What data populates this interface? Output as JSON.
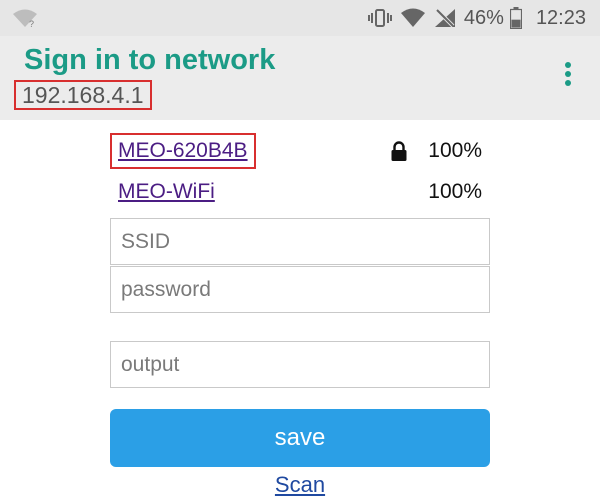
{
  "status_bar": {
    "battery_percent_text": "46%",
    "battery_level": 0.46,
    "time": "12:23",
    "icons": [
      "wifi-question-icon",
      "vibrate-icon",
      "signal-icon",
      "no-signal-icon",
      "battery-icon"
    ]
  },
  "header": {
    "title": "Sign in to network",
    "url": "192.168.4.1",
    "menu_icon": "overflow-menu-icon"
  },
  "networks": [
    {
      "ssid": "MEO-620B4B",
      "secured": true,
      "signal": "100%"
    },
    {
      "ssid": "MEO-WiFi",
      "secured": false,
      "signal": "100%"
    }
  ],
  "form": {
    "ssid_placeholder": "SSID",
    "password_placeholder": "password",
    "output_placeholder": "output",
    "save_label": "save",
    "scan_label": "Scan"
  },
  "colors": {
    "title": "#1b9b86",
    "highlight_box": "#d82f2f",
    "save_button": "#2b9fe6",
    "link": "#4b1d83"
  }
}
